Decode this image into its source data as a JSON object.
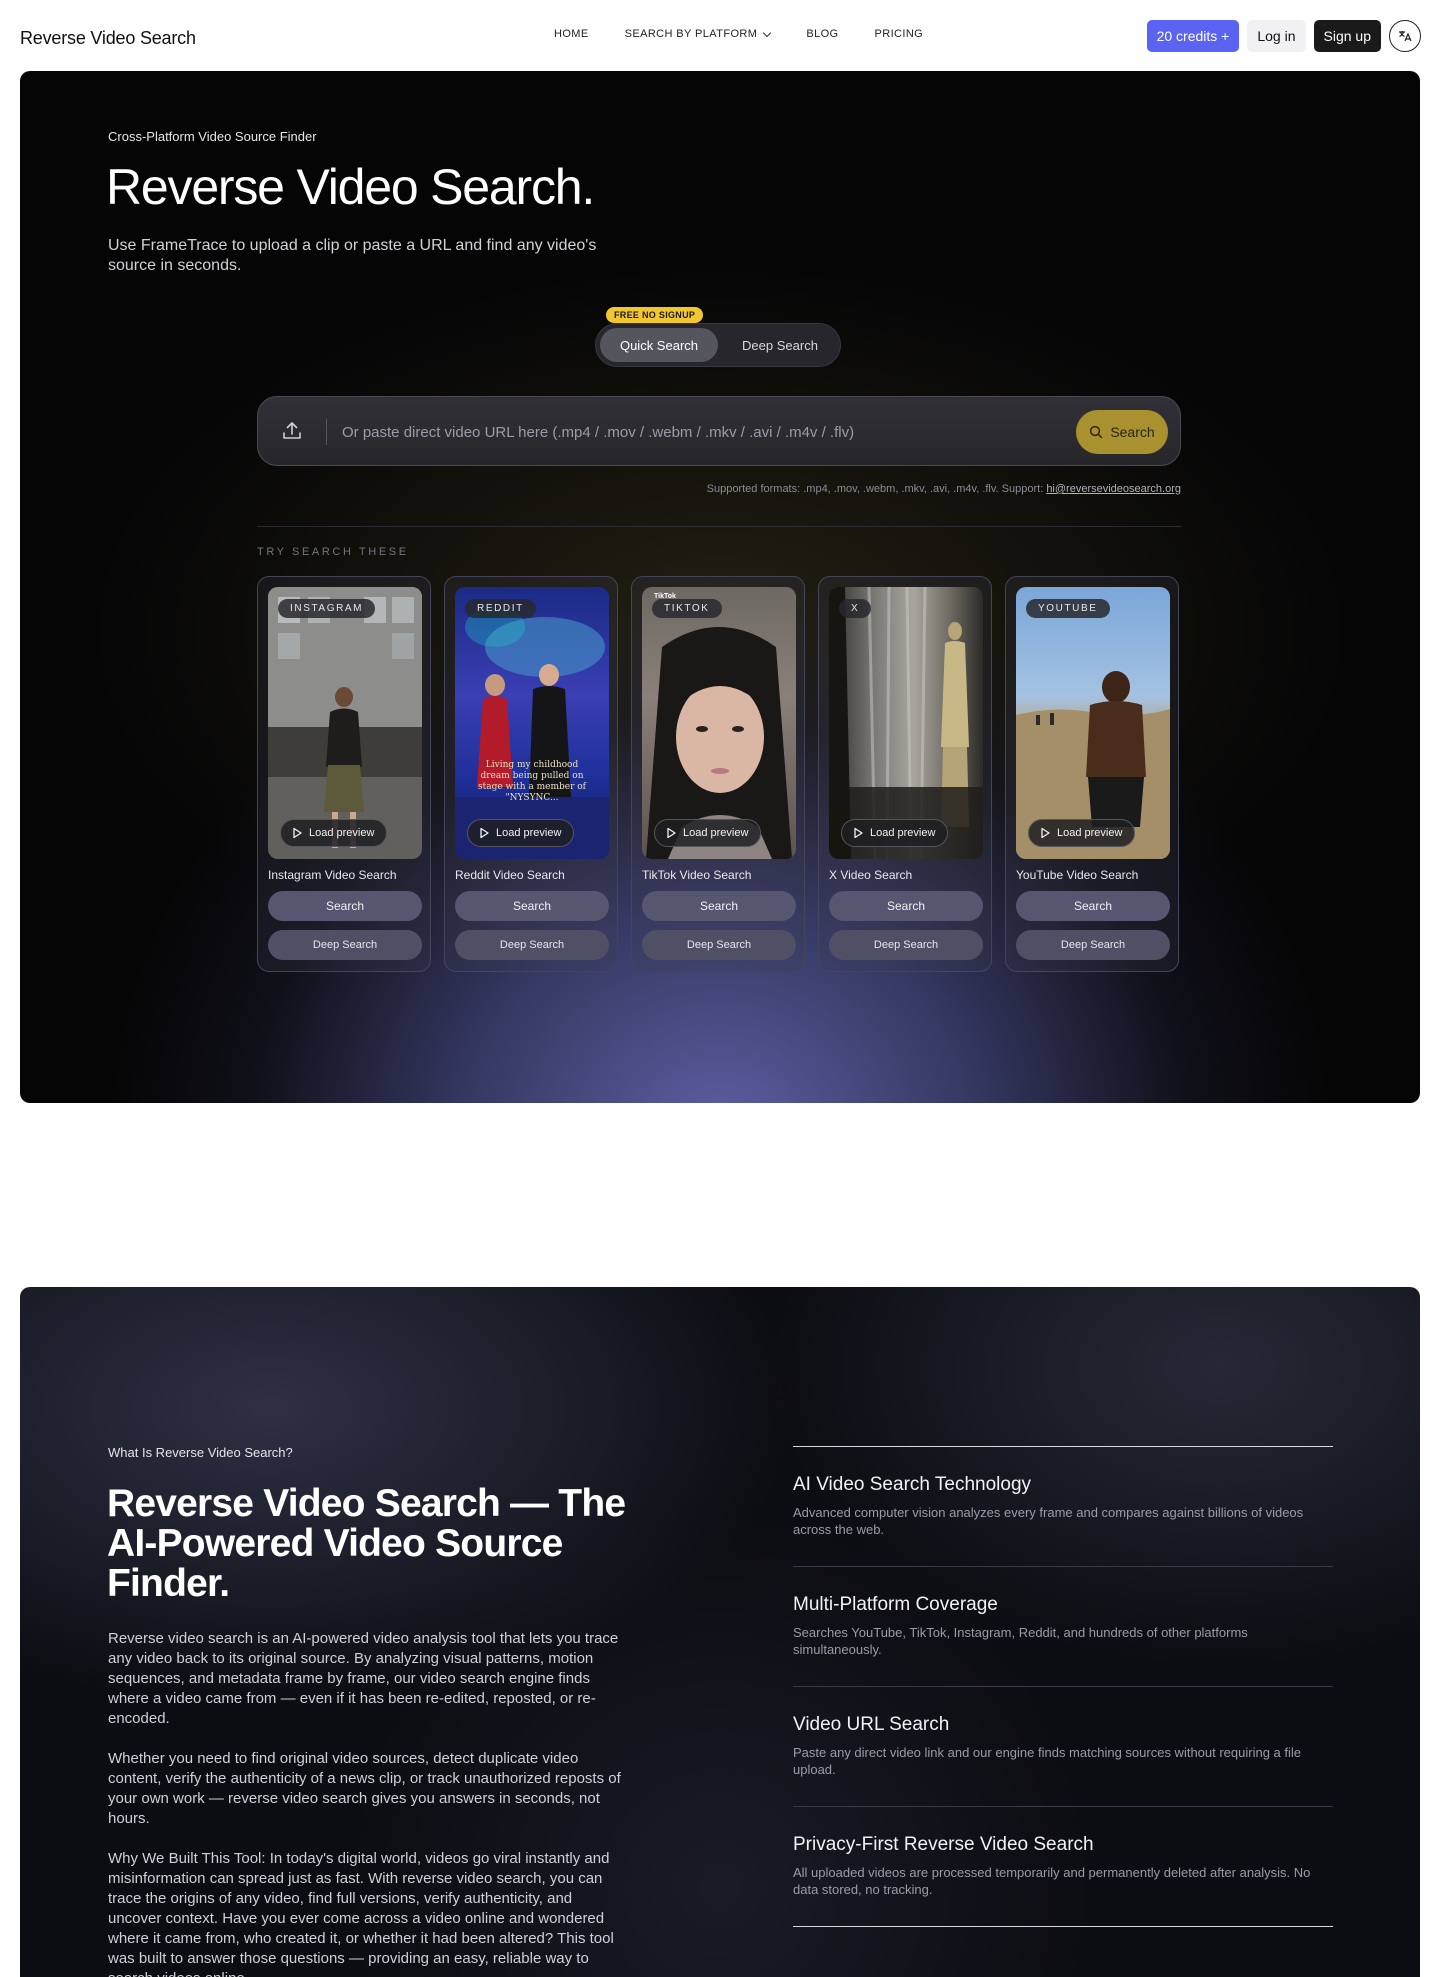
{
  "nav": {
    "brand": "Reverse Video Search",
    "links": {
      "home": "HOME",
      "platform": "SEARCH BY PLATFORM",
      "blog": "BLOG",
      "pricing": "PRICING"
    },
    "credits": "20 credits +",
    "login": "Log in",
    "signup": "Sign up",
    "lang_icon": "translate-icon"
  },
  "hero": {
    "eyebrow": "Cross-Platform Video Source Finder",
    "title": "Reverse Video Search.",
    "subtitle": "Use FrameTrace to upload a clip or paste a URL and find any video's source in seconds.",
    "badge": "FREE NO SIGNUP",
    "toggle": {
      "quick": "Quick Search",
      "deep": "Deep Search"
    },
    "search": {
      "placeholder": "Or paste direct video URL here (.mp4 / .mov / .webm / .mkv / .avi / .m4v / .flv)",
      "button": "Search"
    },
    "support_text": "Supported formats: .mp4, .mov, .webm, .mkv, .avi, .m4v, .flv. Support: ",
    "support_email": "hi@reversevideosearch.org",
    "try_label": "TRY SEARCH THESE",
    "cards": [
      {
        "platform": "INSTAGRAM",
        "title": "Instagram Video Search",
        "preview": "Load preview",
        "search": "Search",
        "deep": "Deep Search"
      },
      {
        "platform": "REDDIT",
        "title": "Reddit Video Search",
        "preview": "Load preview",
        "search": "Search",
        "deep": "Deep Search"
      },
      {
        "platform": "TIKTOK",
        "title": "TikTok Video Search",
        "preview": "Load preview",
        "search": "Search",
        "deep": "Deep Search"
      },
      {
        "platform": "X",
        "title": "X Video Search",
        "preview": "Load preview",
        "search": "Search",
        "deep": "Deep Search"
      },
      {
        "platform": "YOUTUBE",
        "title": "YouTube Video Search",
        "preview": "Load preview",
        "search": "Search",
        "deep": "Deep Search"
      }
    ],
    "reddit_caption": "Living my childhood dream being pulled on stage with a member of \"NYSYNC...",
    "tiktok_watermark": "TikTok"
  },
  "about": {
    "eyebrow": "What Is Reverse Video Search?",
    "title": "Reverse Video Search — The AI-Powered Video Source Finder.",
    "p1": "Reverse video search is an AI-powered video analysis tool that lets you trace any video back to its original source. By analyzing visual patterns, motion sequences, and metadata frame by frame, our video search engine finds where a video came from — even if it has been re-edited, reposted, or re-encoded.",
    "p2": "Whether you need to find original video sources, detect duplicate video content, verify the authenticity of a news clip, or track unauthorized reposts of your own work — reverse video search gives you answers in seconds, not hours.",
    "p3": "Why We Built This Tool: In today's digital world, videos go viral instantly and misinformation can spread just as fast. With reverse video search, you can trace the origins of any video, find full versions, verify authenticity, and uncover context. Have you ever come across a video online and wondered where it came from, who created it, or whether it had been altered? This tool was built to answer those questions — providing an easy, reliable way to search videos online.",
    "features": [
      {
        "title": "AI Video Search Technology",
        "desc": "Advanced computer vision analyzes every frame and compares against billions of videos across the web."
      },
      {
        "title": "Multi-Platform Coverage",
        "desc": "Searches YouTube, TikTok, Instagram, Reddit, and hundreds of other platforms simultaneously."
      },
      {
        "title": "Video URL Search",
        "desc": "Paste any direct video link and our engine finds matching sources without requiring a file upload."
      },
      {
        "title": "Privacy-First Reverse Video Search",
        "desc": "All uploaded videos are processed temporarily and permanently deleted after analysis. No data stored, no tracking."
      }
    ]
  },
  "colors": {
    "accent": "#5b63f2",
    "search_button": "#a8912e",
    "badge": "#f1c630"
  }
}
